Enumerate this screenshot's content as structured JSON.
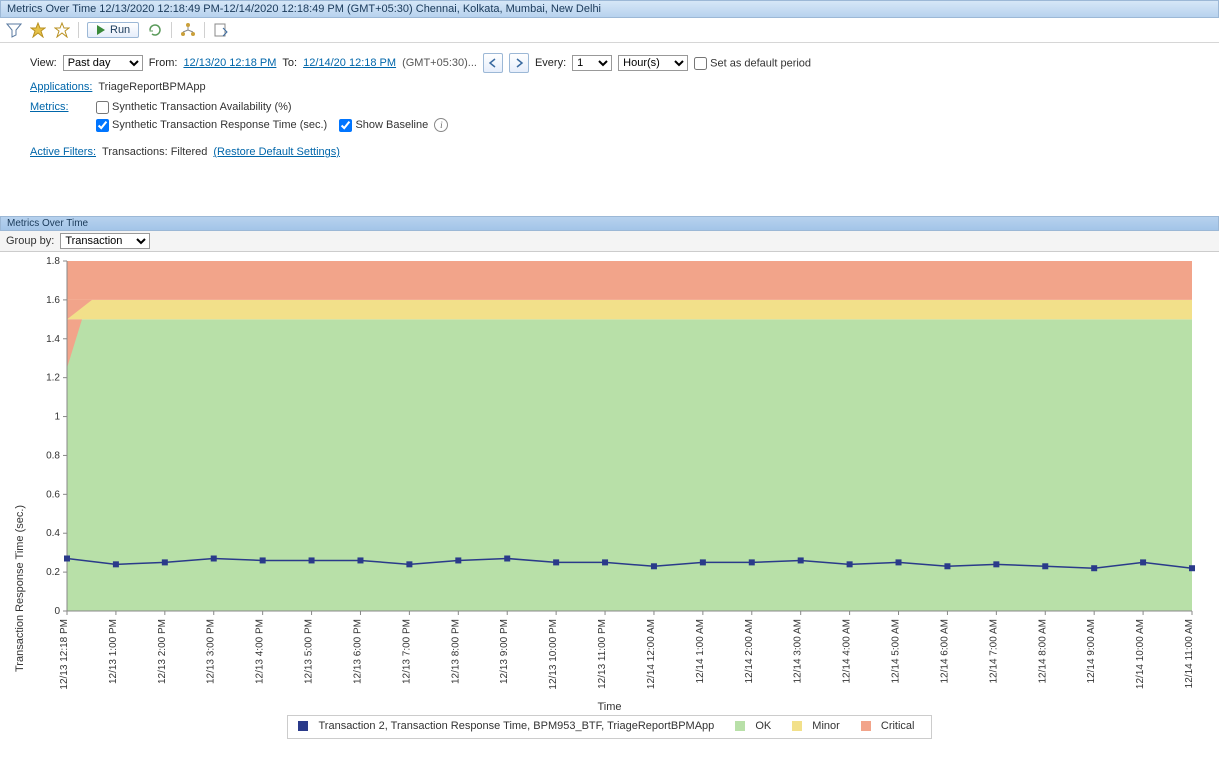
{
  "titlebar": "Metrics Over Time 12/13/2020 12:18:49 PM-12/14/2020 12:18:49 PM (GMT+05:30) Chennai, Kolkata, Mumbai, New Delhi",
  "toolbar": {
    "run": "Run"
  },
  "filters": {
    "view_label": "View:",
    "view_value": "Past day",
    "from_label": "From:",
    "from_value": "12/13/20 12:18 PM",
    "to_label": "To:",
    "to_value": "12/14/20 12:18 PM",
    "tz": "(GMT+05:30)...",
    "every_label": "Every:",
    "every_n": "1",
    "every_unit": "Hour(s)",
    "default_label": "Set as default period",
    "apps_label": "Applications:",
    "apps_value": "TriageReportBPMApp",
    "metrics_label": "Metrics:",
    "metric1": "Synthetic Transaction Availability (%)",
    "metric2": "Synthetic Transaction Response Time (sec.)",
    "baseline": "Show Baseline",
    "af_label": "Active Filters:",
    "af_text": "Transactions: Filtered",
    "af_restore": "(Restore Default Settings)"
  },
  "panel": {
    "title": "Metrics Over Time",
    "groupby_label": "Group by:",
    "groupby_value": "Transaction"
  },
  "legend": {
    "s1": "Transaction 2, Transaction Response Time, BPM953_BTF, TriageReportBPMApp",
    "ok": "OK",
    "minor": "Minor",
    "critical": "Critical"
  },
  "axis": {
    "x": "Time",
    "y": "Transaction Response Time  (sec.)"
  },
  "chart_data": {
    "type": "line",
    "ylabel": "Transaction Response Time  (sec.)",
    "xlabel": "Time",
    "ylim": [
      0,
      1.8
    ],
    "bands": {
      "ok": [
        0,
        1.5
      ],
      "minor": [
        1.5,
        1.6
      ],
      "critical": [
        1.6,
        1.8
      ]
    },
    "categories": [
      "12/13 12:18 PM",
      "12/13 1:00 PM",
      "12/13 2:00 PM",
      "12/13 3:00 PM",
      "12/13 4:00 PM",
      "12/13 5:00 PM",
      "12/13 6:00 PM",
      "12/13 7:00 PM",
      "12/13 8:00 PM",
      "12/13 9:00 PM",
      "12/13 10:00 PM",
      "12/13 11:00 PM",
      "12/14 12:00 AM",
      "12/14 1:00 AM",
      "12/14 2:00 AM",
      "12/14 3:00 AM",
      "12/14 4:00 AM",
      "12/14 5:00 AM",
      "12/14 6:00 AM",
      "12/14 7:00 AM",
      "12/14 8:00 AM",
      "12/14 9:00 AM",
      "12/14 10:00 AM",
      "12/14 11:00 AM"
    ],
    "series": [
      {
        "name": "Transaction 2, Transaction Response Time, BPM953_BTF, TriageReportBPMApp",
        "values": [
          0.27,
          0.24,
          0.25,
          0.27,
          0.26,
          0.26,
          0.26,
          0.24,
          0.26,
          0.27,
          0.25,
          0.25,
          0.23,
          0.25,
          0.25,
          0.26,
          0.24,
          0.25,
          0.23,
          0.24,
          0.23,
          0.22,
          0.25,
          0.22
        ]
      }
    ]
  }
}
